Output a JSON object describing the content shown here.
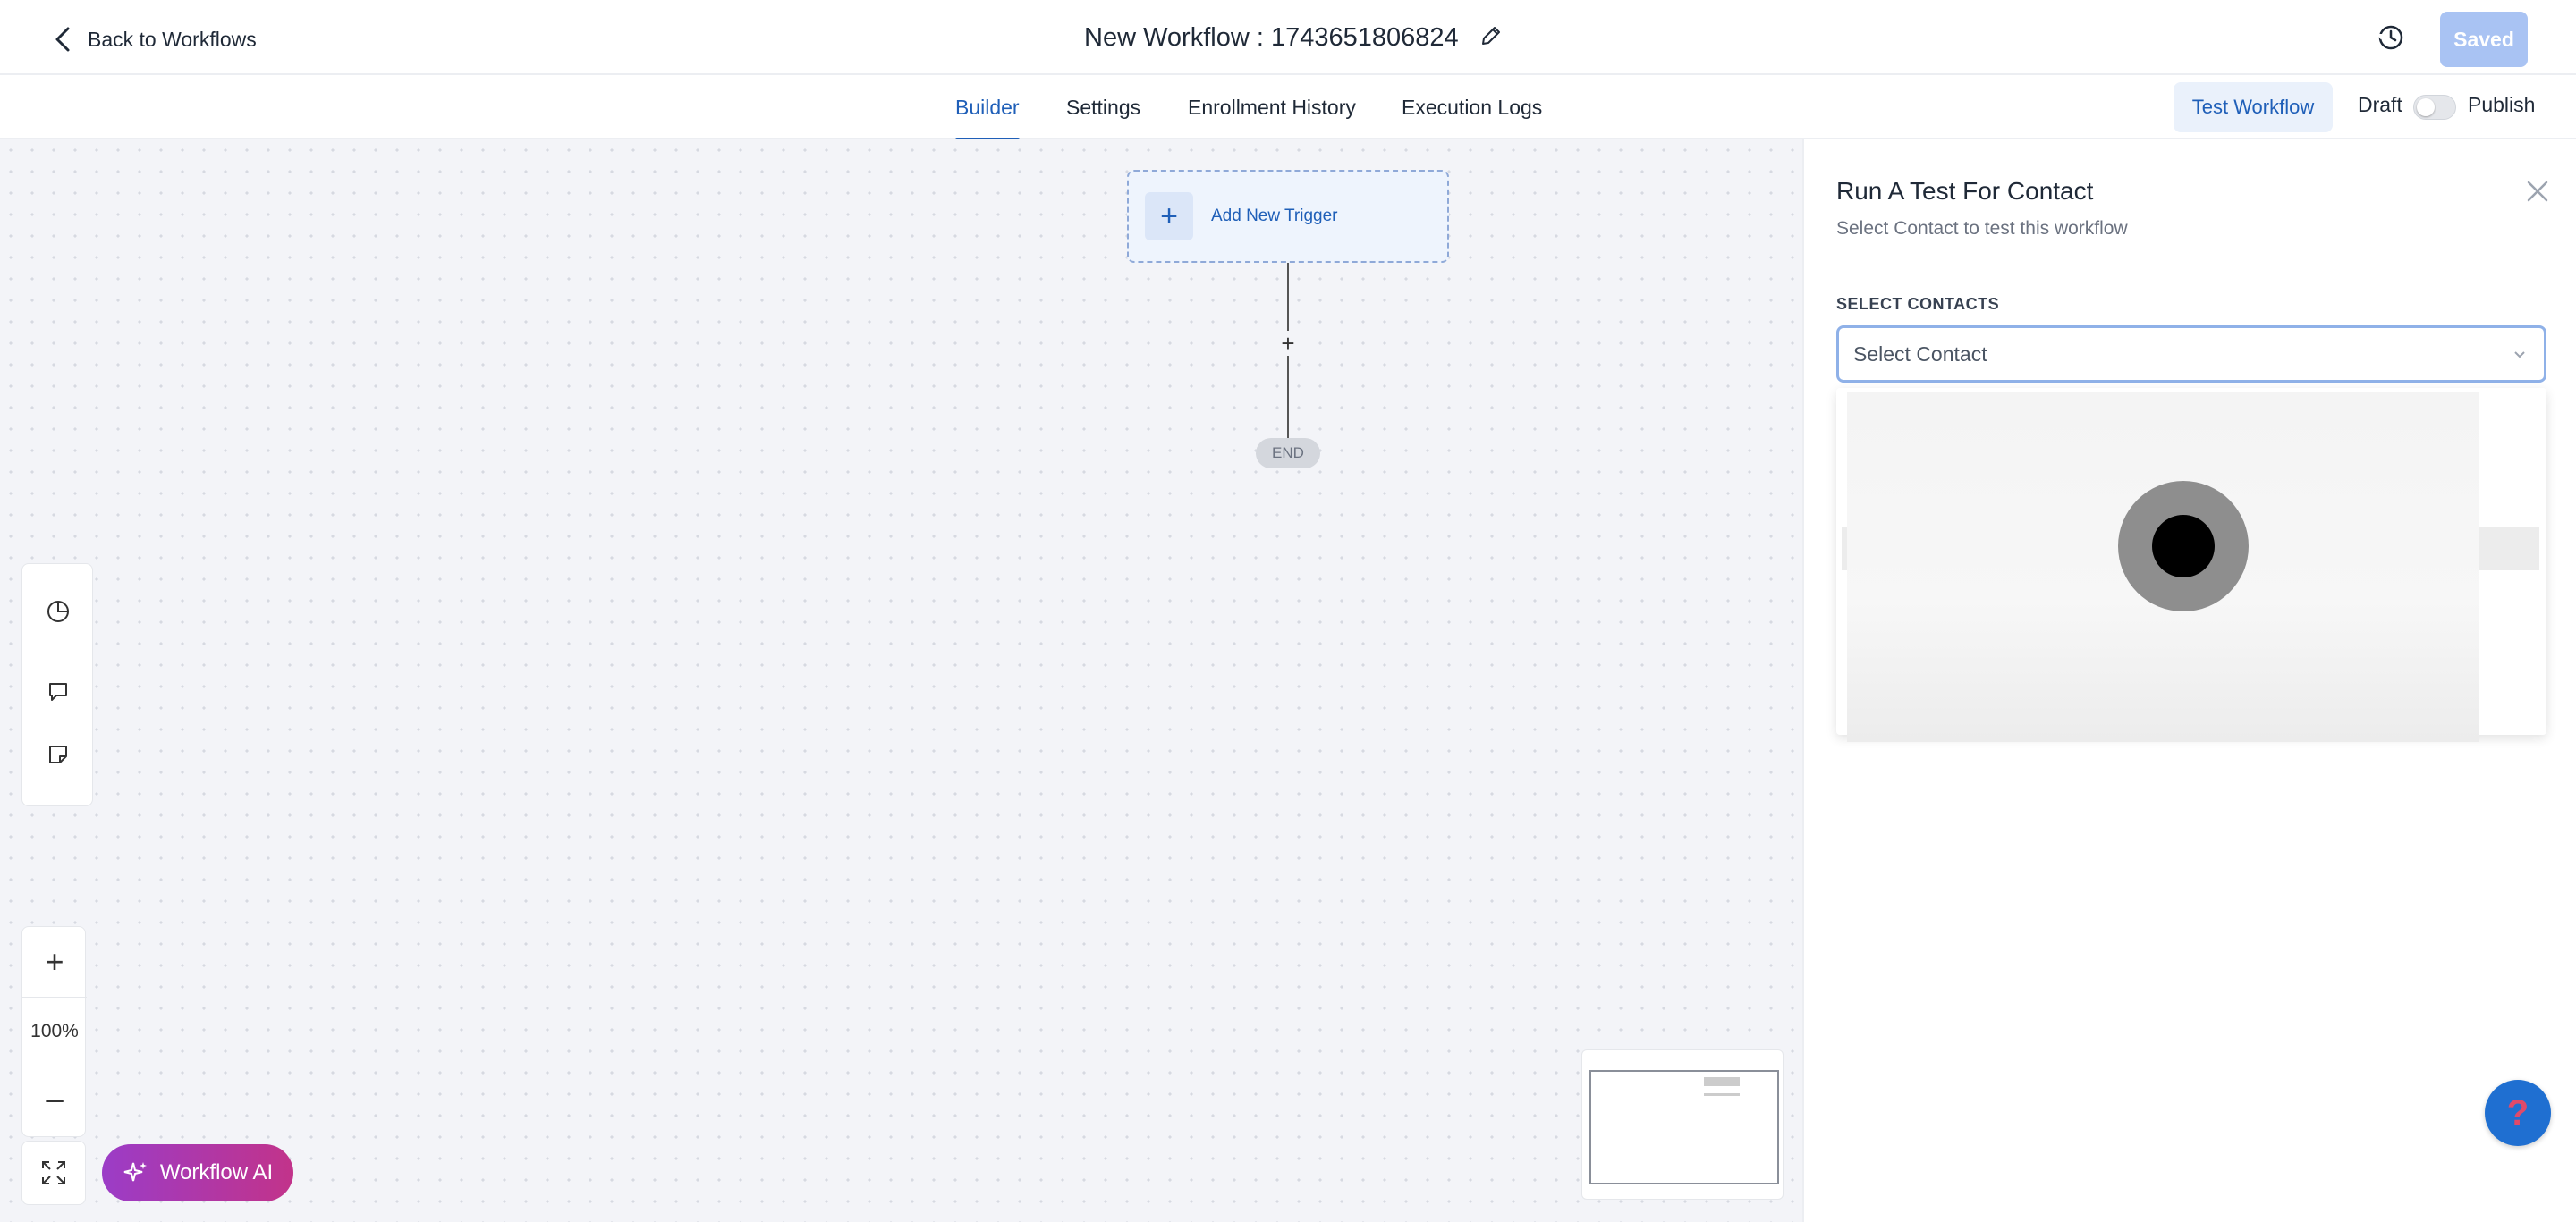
{
  "header": {
    "back_label": "Back to Workflows",
    "title": "New Workflow : 1743651806824",
    "saved_label": "Saved"
  },
  "tabs": [
    {
      "label": "Builder",
      "active": true
    },
    {
      "label": "Settings",
      "active": false
    },
    {
      "label": "Enrollment History",
      "active": false
    },
    {
      "label": "Execution Logs",
      "active": false
    }
  ],
  "actions": {
    "test_label": "Test Workflow",
    "draft_label": "Draft",
    "publish_label": "Publish",
    "published": false
  },
  "canvas": {
    "trigger_label": "Add New Trigger",
    "add_step_symbol": "+",
    "end_label": "END",
    "zoom_in_symbol": "+",
    "zoom_level": "100%",
    "zoom_out_symbol": "−",
    "ai_label": "Workflow AI"
  },
  "panel": {
    "title": "Run A Test For Contact",
    "subtitle": "Select Contact to test this workflow",
    "field_label": "SELECT CONTACTS",
    "select_placeholder": "Select Contact"
  },
  "colors": {
    "accent": "#1f5fb8",
    "saved_button": "#a9c3f3",
    "ai_gradient_start": "#9b3cc7",
    "ai_gradient_end": "#c2338a",
    "help_button": "#1f6fd1"
  },
  "icons": {
    "back": "chevron-left-icon",
    "edit": "pencil-icon",
    "history": "history-icon",
    "analytics": "pie-chart-icon",
    "comment": "comment-icon",
    "note": "sticky-note-icon",
    "fit": "expand-icon",
    "ai": "sparkle-icon",
    "close": "close-icon",
    "dropdown": "chevron-down-icon",
    "help": "help-icon"
  }
}
